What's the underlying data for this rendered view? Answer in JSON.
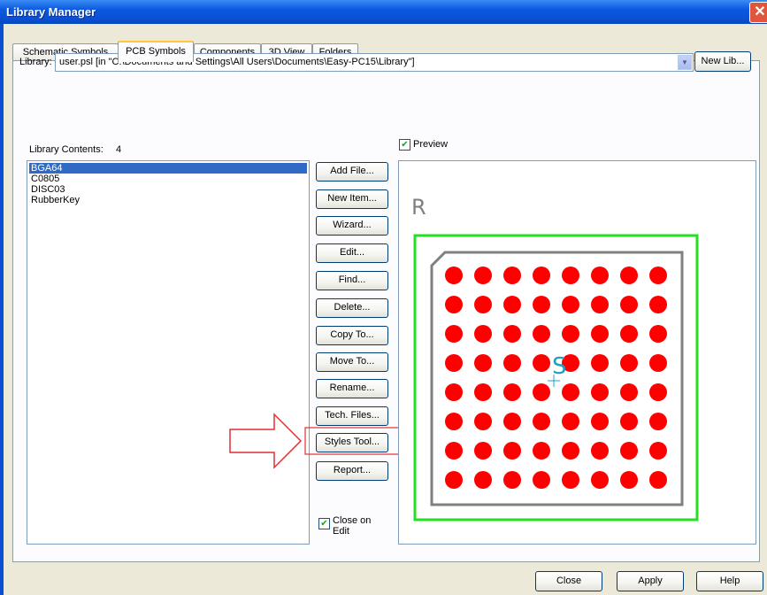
{
  "window": {
    "title": "Library Manager",
    "close_symbol": "✕"
  },
  "tabs": [
    "Schematic Symbols",
    "PCB Symbols",
    "Components",
    "3D View",
    "Folders"
  ],
  "active_tab": "PCB Symbols",
  "library": {
    "label": "Library:",
    "value": "user.psl   [in \"C:\\Documents and Settings\\All Users\\Documents\\Easy-PC15\\Library\"]",
    "new_lib_button": "New Lib..."
  },
  "contents": {
    "label": "Library Contents:",
    "count": "4",
    "items": [
      "BGA64",
      "C0805",
      "DISC03",
      "RubberKey"
    ],
    "selected": "BGA64"
  },
  "buttons": {
    "add_file": "Add File...",
    "new_item": "New Item...",
    "wizard": "Wizard...",
    "edit": "Edit...",
    "find": "Find...",
    "delete": "Delete...",
    "copy_to": "Copy To...",
    "move_to": "Move To...",
    "rename": "Rename...",
    "tech_files": "Tech. Files...",
    "styles_tool": "Styles Tool...",
    "report": "Report..."
  },
  "close_on_edit": {
    "label": "Close on Edit",
    "checked": true
  },
  "preview": {
    "label": "Preview",
    "checked": true,
    "ref_label": "R",
    "center_label": "S",
    "pad_rows": 8,
    "pad_cols": 8,
    "colors": {
      "outline": "#22e022",
      "body": "#808080",
      "pad": "#ff0000",
      "origin": "#20a0c0"
    }
  },
  "footer": {
    "close": "Close",
    "apply": "Apply",
    "help": "Help"
  },
  "highlight": {
    "color": "#e03030",
    "target": "styles-tool-button"
  }
}
